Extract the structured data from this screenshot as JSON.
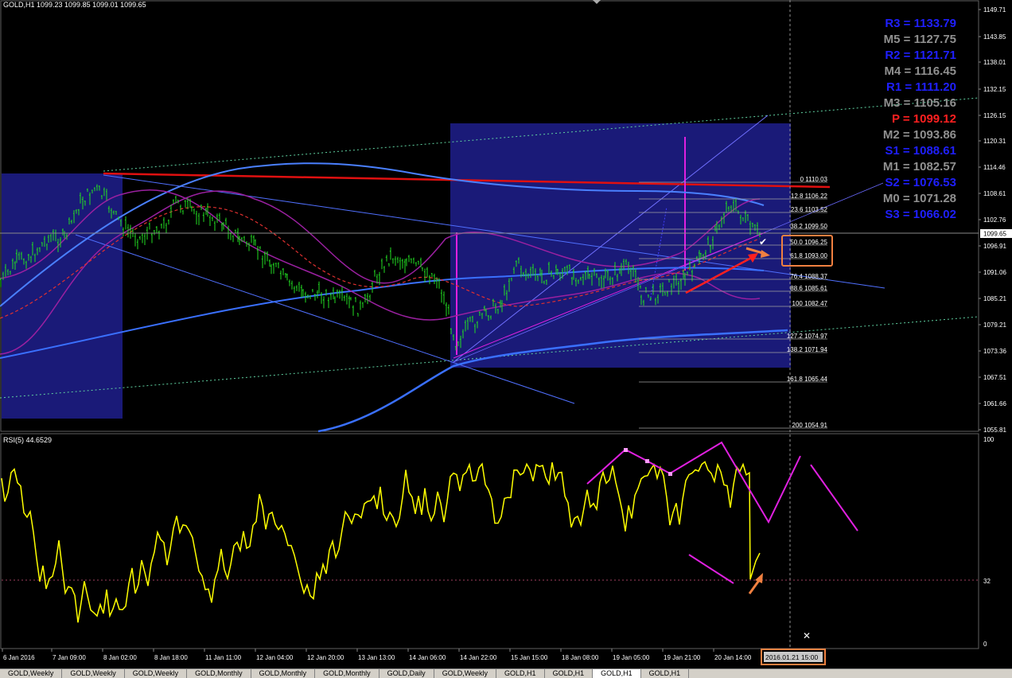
{
  "header": {
    "symbol_title": "GOLD,H1  1099.23 1099.85 1099.01 1099.65"
  },
  "rsi": {
    "title": "RSI(5) 44.6529",
    "scale_top": "100",
    "scale_level": "32",
    "scale_bottom": "0"
  },
  "price_axis": {
    "labels": [
      "1149.71",
      "1143.85",
      "1138.01",
      "1132.15",
      "1126.15",
      "1120.31",
      "1114.46",
      "1108.61",
      "1102.76",
      "1099.65",
      "1096.91",
      "1091.06",
      "1085.21",
      "1079.21",
      "1073.36",
      "1067.51",
      "1061.66",
      "1055.81"
    ],
    "current_price": "1099.65"
  },
  "time_axis": {
    "labels": [
      "6 Jan 2016",
      "7 Jan 09:00",
      "8 Jan 02:00",
      "8 Jan 18:00",
      "11 Jan 11:00",
      "12 Jan 04:00",
      "12 Jan 20:00",
      "13 Jan 13:00",
      "14 Jan 06:00",
      "14 Jan 22:00",
      "15 Jan 15:00",
      "18 Jan 08:00",
      "19 Jan 05:00",
      "19 Jan 21:00",
      "20 Jan 14:00"
    ],
    "cursor_time": "2016.01.21 15:00"
  },
  "pivots": [
    {
      "label": "R3 = 1133.79",
      "color": "#1f1fff"
    },
    {
      "label": "M5 = 1127.75",
      "color": "#909090"
    },
    {
      "label": "R2 = 1121.71",
      "color": "#1f1fff"
    },
    {
      "label": "M4 = 1116.45",
      "color": "#909090"
    },
    {
      "label": "R1 = 1111.20",
      "color": "#1f1fff"
    },
    {
      "label": "M3 = 1105.16",
      "color": "#909090"
    },
    {
      "label": "P   = 1099.12",
      "color": "#ff2020"
    },
    {
      "label": "M2 = 1093.86",
      "color": "#909090"
    },
    {
      "label": "S1 = 1088.61",
      "color": "#1f1fff"
    },
    {
      "label": "M1 = 1082.57",
      "color": "#909090"
    },
    {
      "label": "S2 = 1076.53",
      "color": "#1f1fff"
    },
    {
      "label": "M0 = 1071.28",
      "color": "#909090"
    },
    {
      "label": "S3 = 1066.02",
      "color": "#1f1fff"
    }
  ],
  "fibonacci": [
    {
      "level": "0 1110.03"
    },
    {
      "level": "12.8 1106.22"
    },
    {
      "level": "23.6 1103.52"
    },
    {
      "level": "38.2 1099.50"
    },
    {
      "level": "50.0 1096.25"
    },
    {
      "level": "61.8 1093.00"
    },
    {
      "level": "76.4 1088.37"
    },
    {
      "level": "88.6 1085.61"
    },
    {
      "level": "100 1082.47"
    },
    {
      "level": "127.2 1074.97"
    },
    {
      "level": "138.2 1071.94"
    },
    {
      "level": "161.8 1065.44"
    },
    {
      "level": "200 1054.91"
    }
  ],
  "tabs": [
    "GOLD,Weekly",
    "GOLD,Weekly",
    "GOLD,Weekly",
    "GOLD,Monthly",
    "GOLD,Monthly",
    "GOLD,Monthly",
    "GOLD,Daily",
    "GOLD,Weekly",
    "GOLD,H1",
    "GOLD,H1",
    "GOLD,H1",
    "GOLD,H1"
  ],
  "active_tab_index": 10,
  "colors": {
    "background": "#000000",
    "candles": "#22dd22",
    "rsi_line": "#ffff00",
    "rect_fill": "#1a1a78",
    "resistance_line": "#e01010",
    "highlight": "#f08040",
    "magenta": "#e020e0"
  }
}
